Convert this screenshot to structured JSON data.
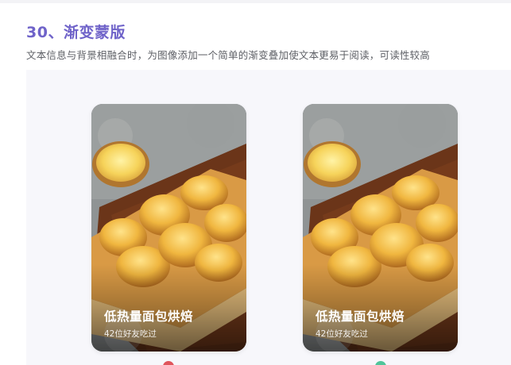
{
  "section": {
    "title": "30、渐变蒙版",
    "description": "文本信息与背景相融合时，为图像添加一个简单的渐变叠加使文本更易于阅读，可读性较高"
  },
  "cards": [
    {
      "name": "低热量面包烘焙",
      "meta": "42位好友吃过"
    },
    {
      "name": "低热量面包烘焙",
      "meta": "42位好友吃过"
    }
  ],
  "colors": {
    "accent": "#6f63c9",
    "bad_dot": "#e0555c",
    "good_dot": "#4fc59a"
  },
  "icons": {
    "bad_example": "red-dot-icon",
    "good_example": "green-dot-icon"
  }
}
